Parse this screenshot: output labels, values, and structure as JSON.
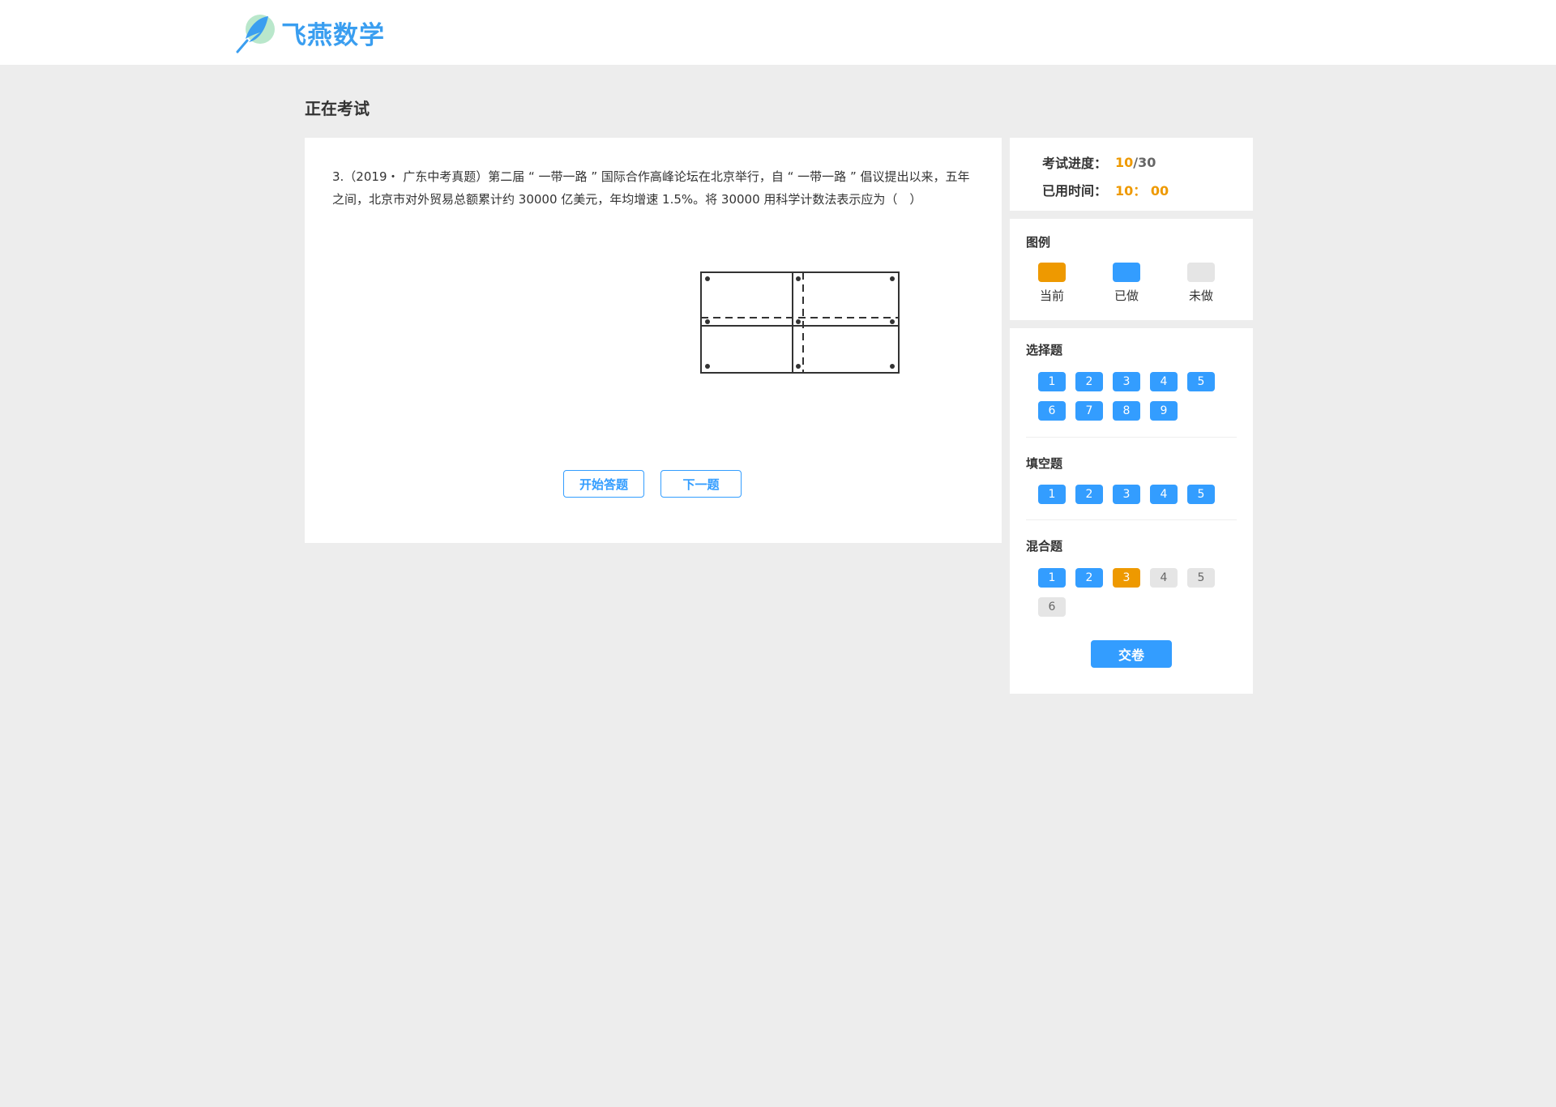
{
  "header": {
    "logo_text": "飞燕数学"
  },
  "page_title": "正在考试",
  "question": {
    "text": "3.（2019・ 广东中考真题）第二届 “ 一带一路 ” 国际合作高峰论坛在北京举行，自 “ 一带一路 ” 倡议提出以来，五年之间，北京市对外贸易总额累计约 30000 亿美元，年均增速 1.5%。将 30000 用科学计数法表示应为（　）",
    "start_label": "开始答题",
    "next_label": "下一题"
  },
  "progress": {
    "label": "考试进度：",
    "current": "10",
    "separator": "/",
    "total": "30",
    "time_label": "已用时间：",
    "time_value": "10： 00"
  },
  "legend": {
    "title": "图例",
    "items": [
      {
        "label": "当前",
        "color": "#ee9900"
      },
      {
        "label": "已做",
        "color": "#339dff"
      },
      {
        "label": "未做",
        "color": "#e5e5e5"
      }
    ]
  },
  "sheet": {
    "sections": [
      {
        "title": "选择题",
        "items": [
          "1",
          "2",
          "3",
          "4",
          "5",
          "6",
          "7",
          "8",
          "9"
        ]
      },
      {
        "title": "填空题",
        "items": [
          "1",
          "2",
          "3",
          "4",
          "5"
        ]
      },
      {
        "title": "混合题",
        "items": [
          "1",
          "2",
          "3",
          "4",
          "5",
          "6"
        ]
      }
    ],
    "submit_label": "交卷"
  }
}
